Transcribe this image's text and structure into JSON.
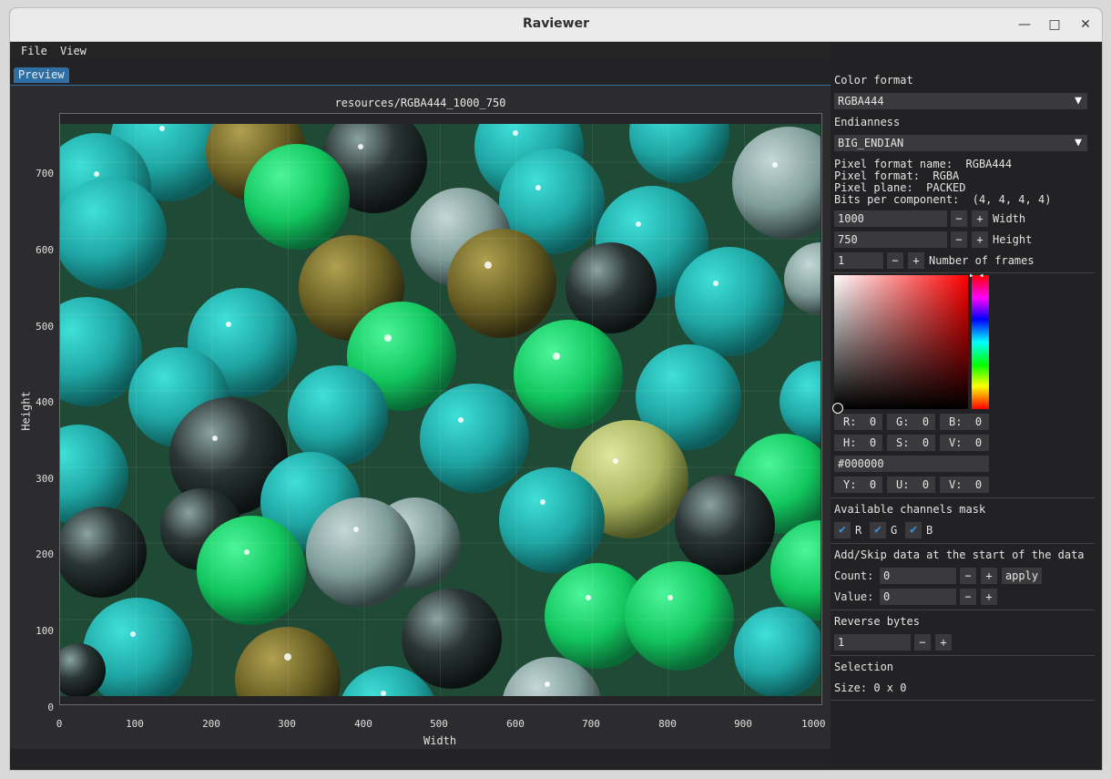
{
  "window": {
    "title": "Raviewer"
  },
  "menu": [
    "File",
    "View"
  ],
  "tabs": {
    "preview": "Preview"
  },
  "plot": {
    "title": "resources/RGBA444_1000_750"
  },
  "chart_data": {
    "type": "heatmap",
    "xlabel": "Width",
    "ylabel": "Height",
    "xlim": [
      0,
      1000
    ],
    "ylim": [
      0,
      750
    ],
    "xticks": [
      "0",
      "100",
      "200",
      "300",
      "400",
      "500",
      "600",
      "700",
      "800",
      "900",
      "1000"
    ],
    "yticks": [
      "0",
      "100",
      "200",
      "300",
      "400",
      "500",
      "600",
      "700"
    ]
  },
  "panel": {
    "color_format_label": "Color format",
    "color_format_value": "RGBA444",
    "endianness_label": "Endianness",
    "endianness_value": "BIG_ENDIAN",
    "info": [
      "Pixel format name:  RGBA444",
      "Pixel format:  RGBA",
      "Pixel plane:  PACKED",
      "Bits per component:  (4, 4, 4, 4)"
    ],
    "width_value": "1000",
    "width_label": "Width",
    "height_value": "750",
    "height_label": "Height",
    "frames_value": "1",
    "frames_label": "Number of frames",
    "minus": "−",
    "plus": "+",
    "rgb": [
      "R:  0",
      "G:  0",
      "B:  0"
    ],
    "hsv": [
      "H:  0",
      "S:  0",
      "V:  0"
    ],
    "hex": "#000000",
    "yuv": [
      "Y:  0",
      "U:  0",
      "V:  0"
    ],
    "channels_label": "Available channels mask",
    "channels": [
      "R",
      "G",
      "B"
    ],
    "addskip_label": "Add/Skip data at the start of the data",
    "count_label": "Count:",
    "count_value": "0",
    "apply_label": "apply",
    "value_label": "Value:",
    "value_value": "0",
    "reverse_label": "Reverse bytes",
    "reverse_value": "1",
    "selection_label": "Selection",
    "selection_size": "Size: 0 x 0"
  },
  "colors": {
    "accent": "#2f6fa4",
    "checkmark": "#3d8fd6"
  }
}
